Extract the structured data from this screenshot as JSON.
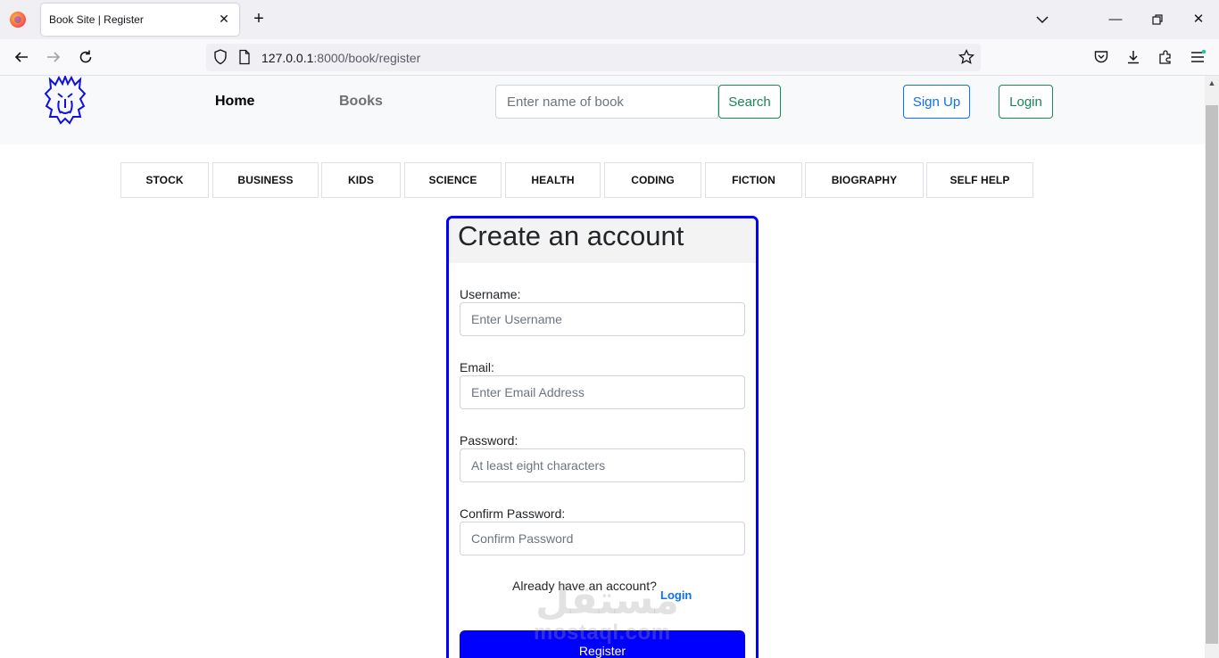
{
  "browser": {
    "tab_title": "Book Site | Register",
    "url_host": "127.0.0.1",
    "url_rest": ":8000/book/register"
  },
  "header": {
    "nav_home": "Home",
    "nav_books": "Books",
    "search_placeholder": "Enter name of book",
    "search_label": "Search",
    "signup_label": "Sign Up",
    "login_label": "Login"
  },
  "categories": [
    "STOCK",
    "BUSINESS",
    "KIDS",
    "SCIENCE",
    "HEALTH",
    "CODING",
    "FICTION",
    "BIOGRAPHY",
    "SELF HELP"
  ],
  "form": {
    "title": "Create an account",
    "username_label": "Username:",
    "username_placeholder": "Enter Username",
    "email_label": "Email:",
    "email_placeholder": "Enter Email Address",
    "password_label": "Password:",
    "password_placeholder": "At least eight characters",
    "confirm_label": "Confirm Password:",
    "confirm_placeholder": "Confirm Password",
    "already_text": "Already have an account?",
    "login_link": "Login",
    "register_label": "Register"
  },
  "watermark": {
    "arabic": "مستقل",
    "latin": "mostaql.com"
  },
  "colors": {
    "brand_blue": "#0000ff",
    "success_green": "#198754",
    "primary_blue": "#0d6efd"
  }
}
